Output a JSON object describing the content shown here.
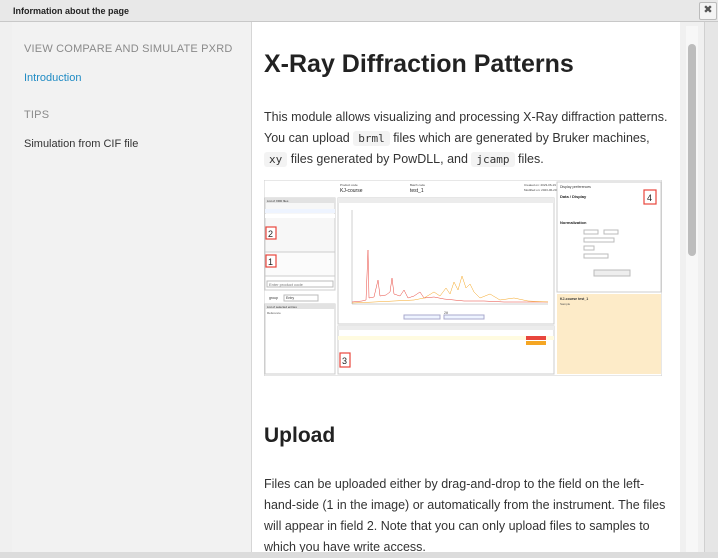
{
  "window": {
    "title": "Information about the page",
    "close_label": "✖"
  },
  "sidebar": {
    "section1": "VIEW COMPARE AND SIMULATE PXRD",
    "link1": "Introduction",
    "section2": "TIPS",
    "item1": "Simulation from CIF file"
  },
  "content": {
    "heading": "X-Ray Diffraction Patterns",
    "intro": {
      "p1": "This module allows visualizing and processing X-Ray diffraction patterns. You can upload",
      "code1": "brml",
      "p2": "files which are generated by Bruker machines,",
      "code2": "xy",
      "p3": "files generated by PowDLL, and",
      "code3": "jcamp",
      "p4": "files."
    },
    "screenshot": {
      "top_left": "Product code",
      "top_left_value": "KJ-course",
      "top_mid": "Batch code",
      "top_mid_value": "test_1",
      "top_right1": "Created on: 2023-06-19",
      "top_right2": "Modified on: 2023-06-20",
      "display_panel": "Display preferences",
      "data_display": "Data / Display",
      "normalization": "Normalization",
      "search_placeholder": "Enter product code",
      "group_label": "group",
      "group_value": "Entry",
      "list_title": "List of XRD files",
      "selected_title": "List of selected entries",
      "reference": "Reference",
      "sample_box_title": "KJ-course test_1",
      "sample_box_sub": "Sample",
      "x_label": "2θ",
      "num1": "1",
      "num2": "2",
      "num3": "3",
      "num4": "4",
      "colors": {
        "red": "#e8453c",
        "orange": "#f5a623",
        "sample_bg": "#fdebc8",
        "highlight": "#fffbe0"
      }
    },
    "upload": {
      "heading": "Upload",
      "p": "Files can be uploaded either by drag-and-drop to the field on the left-hand-side (1 in the image) or automatically from the instrument. The files will appear in field 2. Note that you can only upload files to samples to which you have write access."
    }
  }
}
